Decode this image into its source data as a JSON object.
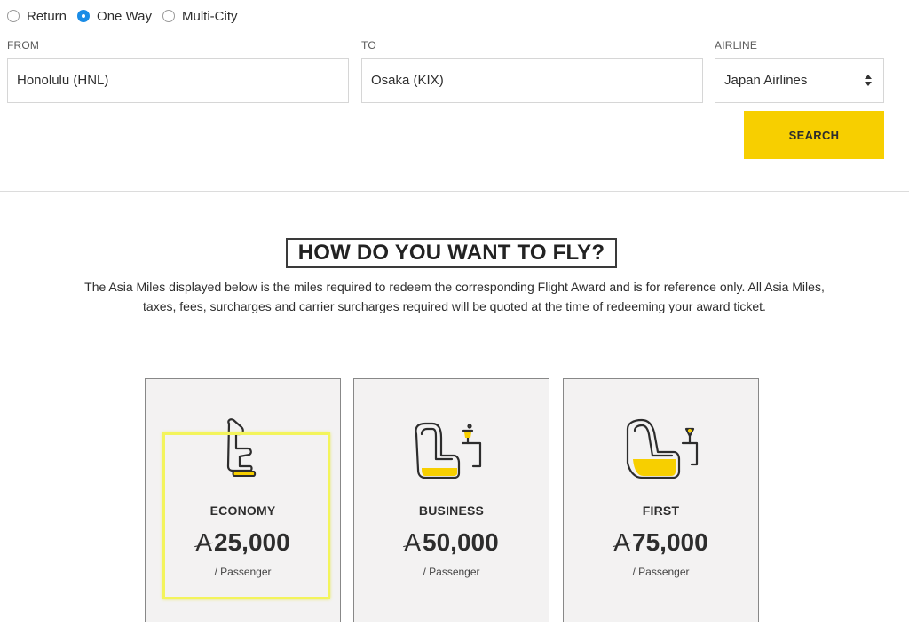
{
  "trip_types": [
    {
      "label": "Return",
      "checked": false
    },
    {
      "label": "One Way",
      "checked": true
    },
    {
      "label": "Multi-City",
      "checked": false
    }
  ],
  "from": {
    "label": "FROM",
    "value": "Honolulu (HNL)"
  },
  "to": {
    "label": "TO",
    "value": "Osaka (KIX)"
  },
  "airline": {
    "label": "AIRLINE",
    "value": "Japan Airlines"
  },
  "search_label": "SEARCH",
  "heading": "HOW DO YOU WANT TO FLY?",
  "intro": "The Asia Miles displayed below is the miles required to redeem the corresponding Flight Award and is for reference only. All Asia Miles, taxes, fees, surcharges and carrier surcharges required will be quoted at the time of redeeming your award ticket.",
  "currency_symbol": "A",
  "cards": [
    {
      "cabin": "ECONOMY",
      "miles": "25,000",
      "per": "/ Passenger",
      "icon": "economy-seat-icon"
    },
    {
      "cabin": "BUSINESS",
      "miles": "50,000",
      "per": "/ Passenger",
      "icon": "business-seat-icon"
    },
    {
      "cabin": "FIRST",
      "miles": "75,000",
      "per": "/ Passenger",
      "icon": "first-seat-icon"
    }
  ],
  "colors": {
    "accent_yellow": "#f7cf00",
    "radio_blue": "#1a8ce6",
    "highlight": "#f3f45b"
  }
}
